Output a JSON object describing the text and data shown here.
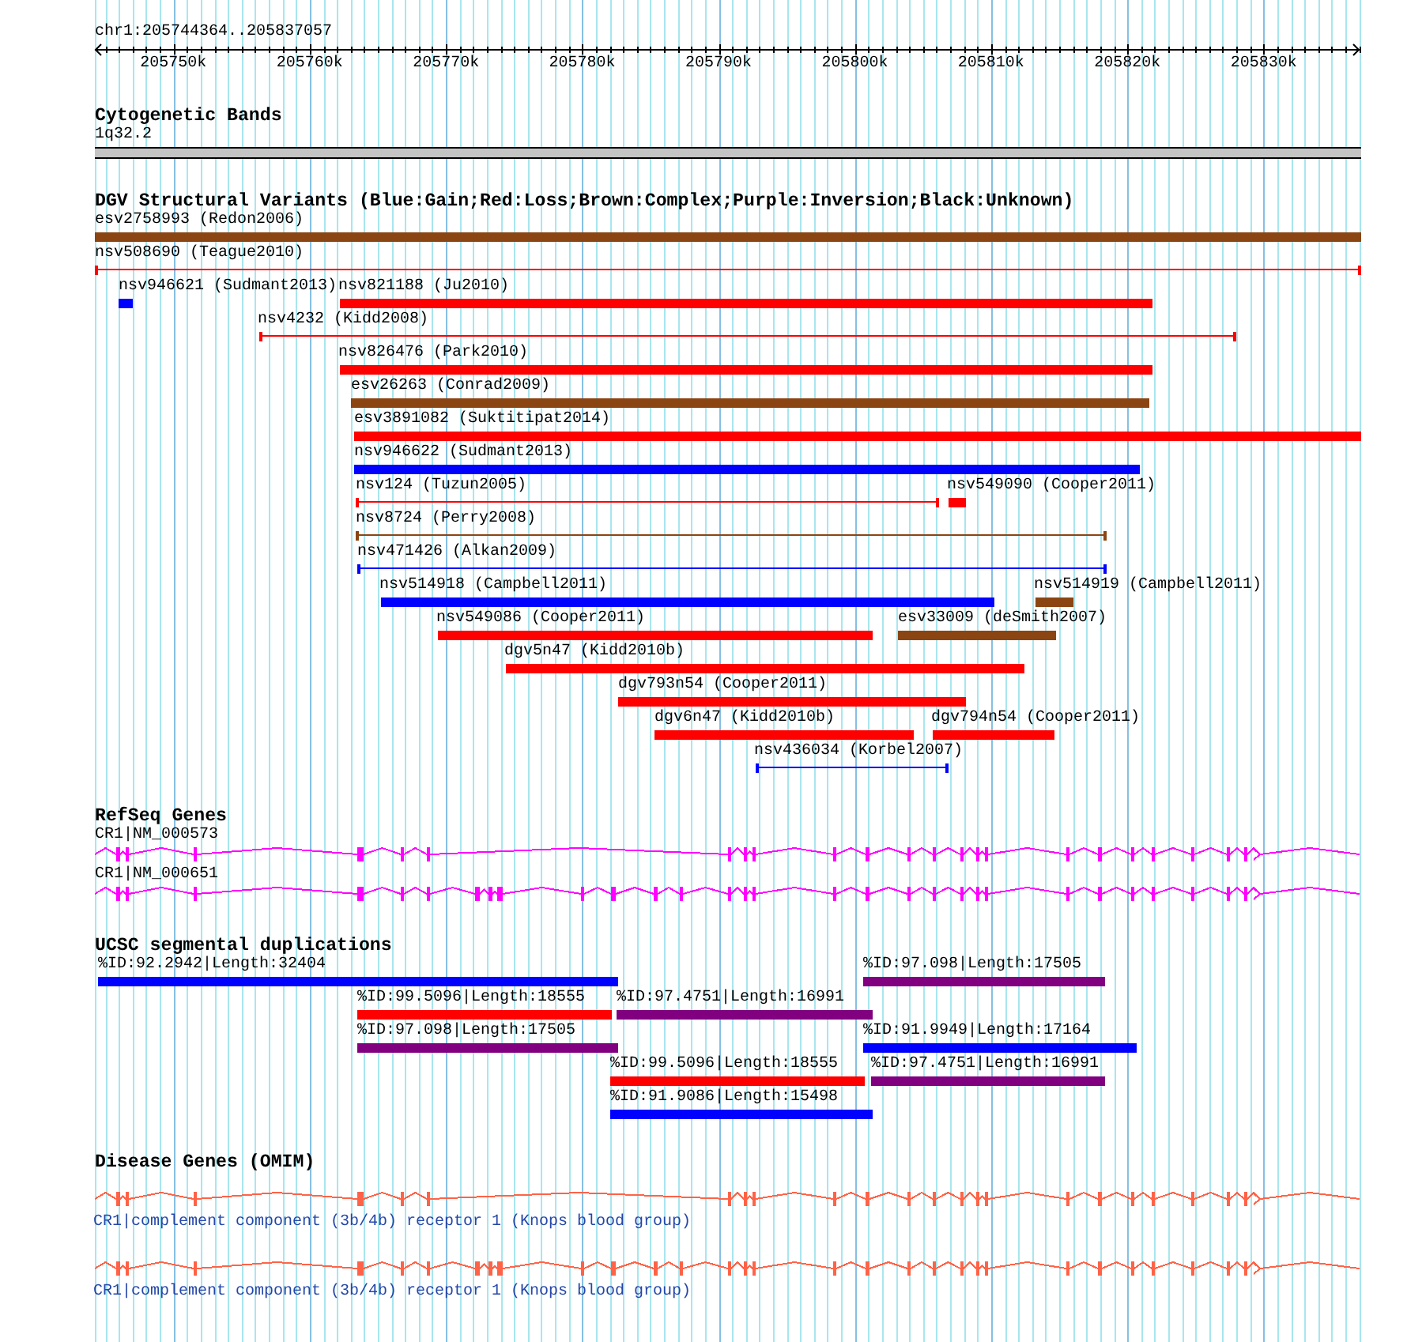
{
  "ruler": {
    "region": "chr1:205744364..205837057",
    "ticks": [
      "205750k",
      "205760k",
      "205770k",
      "205780k",
      "205790k",
      "205800k",
      "205810k",
      "205820k",
      "205830k"
    ]
  },
  "tracks": [
    {
      "kind": "cytoband",
      "title": "Cytogenetic Bands",
      "features": [
        {
          "label": "1q32.2"
        }
      ]
    },
    {
      "kind": "variants",
      "title": "DGV Structural Variants (Blue:Gain;Red:Loss;Brown:Complex;Purple:Inversion;Black:Unknown)",
      "features": [
        {
          "label": "esv2758993 (Redon2006)",
          "kind": "bar",
          "color": "#8b4513"
        },
        {
          "label": "nsv508690 (Teague2010)",
          "kind": "span",
          "color": "#ff0000"
        },
        {
          "label": "nsv946621 (Sudmant2013)",
          "kind": "bar",
          "color": "#0000ff"
        },
        {
          "label": "nsv821188 (Ju2010)",
          "kind": "bar",
          "color": "#ff0000"
        },
        {
          "label": "nsv4232 (Kidd2008)",
          "kind": "span",
          "color": "#ff0000"
        },
        {
          "label": "nsv826476 (Park2010)",
          "kind": "bar",
          "color": "#ff0000"
        },
        {
          "label": "esv26263 (Conrad2009)",
          "kind": "bar",
          "color": "#8b4513"
        },
        {
          "label": "esv3891082 (Suktitipat2014)",
          "kind": "bar",
          "color": "#ff0000"
        },
        {
          "label": "nsv946622 (Sudmant2013)",
          "kind": "bar",
          "color": "#0000ff"
        },
        {
          "label": "nsv124 (Tuzun2005)",
          "kind": "span",
          "color": "#ff0000"
        },
        {
          "label": "nsv549090 (Cooper2011)",
          "kind": "bar",
          "color": "#ff0000"
        },
        {
          "label": "nsv8724 (Perry2008)",
          "kind": "span",
          "color": "#8b4513"
        },
        {
          "label": "nsv471426 (Alkan2009)",
          "kind": "span",
          "color": "#0000ff"
        },
        {
          "label": "nsv514918 (Campbell2011)",
          "kind": "bar",
          "color": "#0000ff"
        },
        {
          "label": "nsv514919 (Campbell2011)",
          "kind": "bar",
          "color": "#8b4513"
        },
        {
          "label": "nsv549086 (Cooper2011)",
          "kind": "bar",
          "color": "#ff0000"
        },
        {
          "label": "esv33009 (deSmith2007)",
          "kind": "bar",
          "color": "#8b4513"
        },
        {
          "label": "dgv5n47 (Kidd2010b)",
          "kind": "bar",
          "color": "#ff0000"
        },
        {
          "label": "dgv793n54 (Cooper2011)",
          "kind": "bar",
          "color": "#ff0000"
        },
        {
          "label": "dgv6n47 (Kidd2010b)",
          "kind": "bar",
          "color": "#ff0000"
        },
        {
          "label": "dgv794n54 (Cooper2011)",
          "kind": "bar",
          "color": "#ff0000"
        },
        {
          "label": "nsv436034 (Korbel2007)",
          "kind": "span",
          "color": "#0000ff"
        }
      ]
    },
    {
      "kind": "genes",
      "title": "RefSeq Genes",
      "features": [
        {
          "label": "CR1|NM_000573"
        },
        {
          "label": "CR1|NM_000651"
        }
      ]
    },
    {
      "kind": "segdups",
      "title": "UCSC segmental duplications",
      "features": [
        {
          "label": "%ID:92.2942|Length:32404",
          "color": "#0000ff"
        },
        {
          "label": "%ID:97.098|Length:17505",
          "color": "#800080"
        },
        {
          "label": "%ID:99.5096|Length:18555",
          "color": "#ff0000"
        },
        {
          "label": "%ID:97.4751|Length:16991",
          "color": "#800080"
        },
        {
          "label": "%ID:97.098|Length:17505",
          "color": "#800080"
        },
        {
          "label": "%ID:91.9949|Length:17164",
          "color": "#0000ff"
        },
        {
          "label": "%ID:99.5096|Length:18555",
          "color": "#ff0000"
        },
        {
          "label": "%ID:97.4751|Length:16991",
          "color": "#800080"
        },
        {
          "label": "%ID:91.9086|Length:15498",
          "color": "#0000ff"
        }
      ]
    },
    {
      "kind": "disease_genes",
      "title": "Disease Genes (OMIM)",
      "features": [
        {
          "label": "CR1|complement component (3b/4b) receptor 1 (Knops blood group)"
        },
        {
          "label": "CR1|complement component (3b/4b) receptor 1 (Knops blood group)"
        }
      ]
    }
  ]
}
